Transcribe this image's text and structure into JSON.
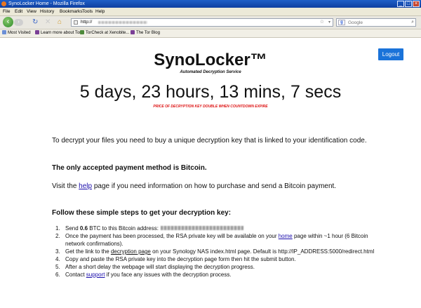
{
  "window": {
    "title": "SynoLocker Home - Mozilla Firefox"
  },
  "menu": [
    "File",
    "Edit",
    "View",
    "History",
    "Bookmarks",
    "Tools",
    "Help"
  ],
  "address_bar": {
    "value": "http://",
    "placeholder": ""
  },
  "search_bar": {
    "engine": "Google",
    "placeholder": "Google"
  },
  "bookmarks": [
    "Most Visited",
    "Learn more about Tor",
    "TorCheck at Xenobite...",
    "The Tor Blog"
  ],
  "page": {
    "logout_label": "Logout",
    "title": "SynoLocker™",
    "subtitle": "Automated Decryption Service",
    "countdown": "5 days, 23 hours, 13 mins, 7 secs",
    "warning": "PRICE OF DECRYPTION KEY DOUBLE WHEN COUNTDOWN EXPIRE",
    "intro": "To decrypt your files you need to buy a unique decryption key that is linked to your identification code.",
    "payment_note": "The only accepted payment method is Bitcoin.",
    "help_text_before": "Visit the ",
    "help_link": "help",
    "help_text_after": " page if you need information on how to purchase and send a Bitcoin payment.",
    "steps_heading": "Follow these simple steps to get your decryption key:",
    "steps": {
      "s1_prefix": "Send ",
      "s1_amount": "0.6",
      "s1_suffix": " BTC to this Bitcoin address:",
      "s2_before": "Once the payment has been processed, the RSA private key will be available on your ",
      "s2_link": "home",
      "s2_after": " page within ~1 hour (6 Bitcoin network confirmations).",
      "s3_before": "Get the link to the ",
      "s3_link": "decryption page",
      "s3_after": " on your Synology NAS index.html page. Default is http://IP_ADDRESS:5000/redirect.html",
      "s4": "Copy and paste the RSA private key into the decryption page form then hit the submit button.",
      "s5": "After a short delay the webpage will start displaying the decryption progress.",
      "s6_before": "Contact ",
      "s6_link": "support",
      "s6_after": " if you face any issues with the decryption process."
    }
  },
  "colors": {
    "logout_button": "#1a73d9",
    "warning_text": "#dd1111",
    "link": "#1a0dab",
    "titlebar": "#1f5fc7"
  },
  "icons": [
    "firefox-icon",
    "back-icon",
    "forward-icon",
    "reload-icon",
    "stop-icon",
    "home-icon",
    "star-icon",
    "search-icon"
  ]
}
